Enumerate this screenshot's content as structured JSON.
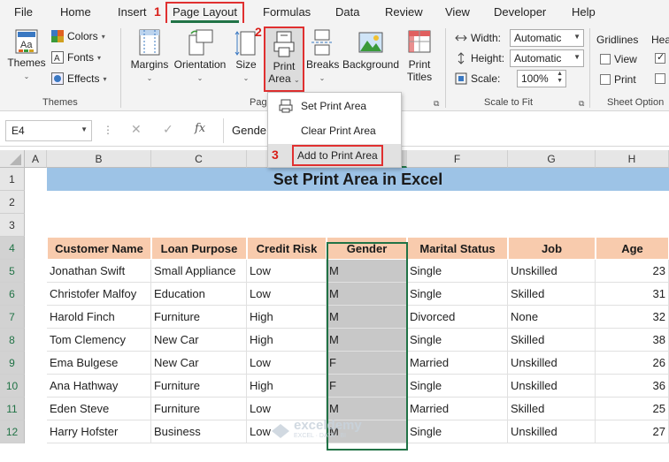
{
  "menu": {
    "items": [
      "File",
      "Home",
      "Insert",
      "Page Layout",
      "Formulas",
      "Data",
      "Review",
      "View",
      "Developer",
      "Help"
    ],
    "active": "Page Layout"
  },
  "steps": {
    "s1": "1",
    "s2": "2",
    "s3": "3"
  },
  "ribbon": {
    "themes": {
      "themes_label": "Themes",
      "colors_label": "Colors",
      "fonts_label": "Fonts",
      "effects_label": "Effects",
      "group_label": "Themes"
    },
    "page_setup": {
      "margins": "Margins",
      "orientation": "Orientation",
      "size": "Size",
      "print_area_line1": "Print",
      "print_area_line2": "Area",
      "breaks": "Breaks",
      "background": "Background",
      "print_titles_line1": "Print",
      "print_titles_line2": "Titles",
      "group_label": "Pag"
    },
    "scale_to_fit": {
      "width_label": "Width:",
      "width_value": "Automatic",
      "height_label": "Height:",
      "height_value": "Automatic",
      "scale_label": "Scale:",
      "scale_value": "100%",
      "group_label": "Scale to Fit"
    },
    "sheet_options": {
      "gridlines_label": "Gridlines",
      "headings_label": "Hea",
      "view_label": "View",
      "print_label": "Print",
      "group_label": "Sheet Option"
    }
  },
  "print_area_menu": {
    "items": [
      "Set Print Area",
      "Clear Print Area",
      "Add to Print Area"
    ]
  },
  "formula_bar": {
    "name_box": "E4",
    "content": "Gende"
  },
  "sheet": {
    "columns": [
      "A",
      "B",
      "C",
      "D",
      "E",
      "F",
      "G",
      "H"
    ],
    "rows": [
      "1",
      "2",
      "3",
      "4",
      "5",
      "6",
      "7",
      "8",
      "9",
      "10",
      "11",
      "12"
    ],
    "title": "Set Print Area in Excel",
    "headers": [
      "Customer Name",
      "Loan Purpose",
      "Credit Risk",
      "Gender",
      "Marital Status",
      "Job",
      "Age"
    ],
    "data": [
      [
        "Jonathan Swift",
        "Small Appliance",
        "Low",
        "M",
        "Single",
        "Unskilled",
        "23"
      ],
      [
        "Christofer Malfoy",
        "Education",
        "Low",
        "M",
        "Single",
        "Skilled",
        "31"
      ],
      [
        "Harold Finch",
        "Furniture",
        "High",
        "M",
        "Divorced",
        "None",
        "32"
      ],
      [
        "Tom Clemency",
        "New Car",
        "High",
        "M",
        "Single",
        "Skilled",
        "38"
      ],
      [
        "Ema Bulgese",
        "New Car",
        "Low",
        "F",
        "Married",
        "Unskilled",
        "26"
      ],
      [
        "Ana Hathway",
        "Furniture",
        "High",
        "F",
        "Single",
        "Unskilled",
        "36"
      ],
      [
        "Eden Steve",
        "Furniture",
        "Low",
        "M",
        "Married",
        "Skilled",
        "25"
      ],
      [
        "Harry Hofster",
        "Business",
        "Low",
        "M",
        "Single",
        "Unskilled",
        "27"
      ]
    ],
    "watermark_name": "exceldemy",
    "watermark_sub": "EXCEL · DATA · BI"
  },
  "colors": {
    "excel_green": "#217346",
    "title_band": "#9dc3e6",
    "header_fill": "#f8cbad",
    "selection_fill": "#c8c8c8",
    "highlight_red": "#e03030"
  }
}
